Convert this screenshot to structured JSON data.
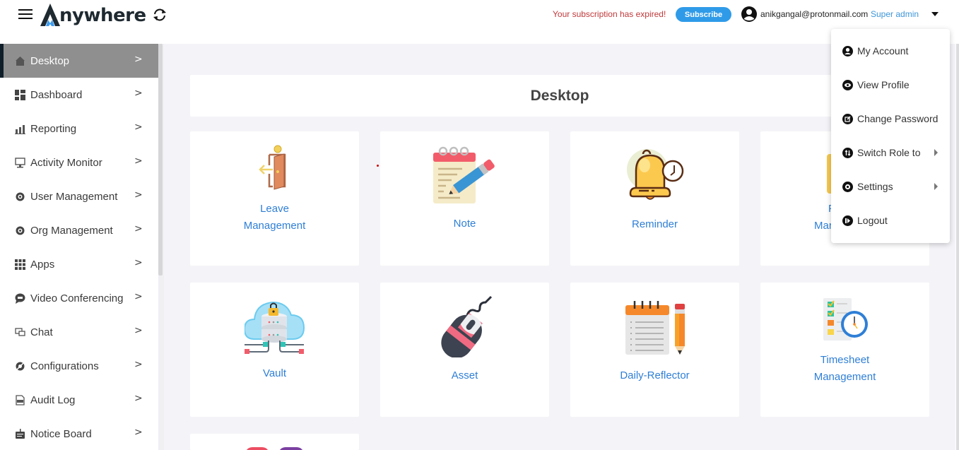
{
  "header": {
    "logo_text": "nywhere",
    "subscription_notice": "Your subscription has expired!",
    "subscribe_label": "Subscribe",
    "user_email": "anikgangal@protonmail.com",
    "user_role": "Super admin"
  },
  "colors": {
    "accent_blue": "#2f9be8",
    "link_blue": "#2f7fd6",
    "expired_red": "#c0393b",
    "sidebar_active": "#8f8f8f",
    "main_bg": "#f4f4f8"
  },
  "sidebar": {
    "items": [
      {
        "label": "Desktop",
        "icon": "home-icon",
        "active": true
      },
      {
        "label": "Dashboard",
        "icon": "dashboard-icon"
      },
      {
        "label": "Reporting",
        "icon": "bar-chart-icon"
      },
      {
        "label": "Activity Monitor",
        "icon": "monitor-icon"
      },
      {
        "label": "User Management",
        "icon": "gear-user-icon"
      },
      {
        "label": "Org Management",
        "icon": "gear-org-icon"
      },
      {
        "label": "Apps",
        "icon": "apps-grid-icon"
      },
      {
        "label": "Video Conferencing",
        "icon": "chat-bubble-icon"
      },
      {
        "label": "Chat",
        "icon": "chat-icon"
      },
      {
        "label": "Configurations",
        "icon": "config-gear-icon"
      },
      {
        "label": "Audit Log",
        "icon": "audit-doc-icon"
      },
      {
        "label": "Notice Board",
        "icon": "notice-board-icon"
      }
    ]
  },
  "main": {
    "title": "Desktop",
    "tiles": [
      {
        "label_lines": [
          "Leave",
          "Management"
        ],
        "icon": "door-exit-icon"
      },
      {
        "label_lines": [
          "Note"
        ],
        "icon": "notepad-pencil-icon"
      },
      {
        "label_lines": [
          "Reminder"
        ],
        "icon": "bell-clock-icon"
      },
      {
        "label_lines": [
          "F",
          "Mar"
        ],
        "icon": "folder-icon"
      },
      {
        "label_lines": [
          "Vault"
        ],
        "icon": "cloud-vault-icon"
      },
      {
        "label_lines": [
          "Asset"
        ],
        "icon": "mouse-icon"
      },
      {
        "label_lines": [
          "Daily-Reflector"
        ],
        "icon": "notebook-pencil-icon"
      },
      {
        "label_lines": [
          "Timesheet",
          "Management"
        ],
        "icon": "checklist-clock-icon"
      }
    ]
  },
  "user_menu": {
    "items": [
      {
        "label": "My Account",
        "icon": "account-icon"
      },
      {
        "label": "View Profile",
        "icon": "eye-icon"
      },
      {
        "label": "Change Password",
        "icon": "edit-icon"
      },
      {
        "label": "Switch Role to",
        "icon": "switch-role-icon",
        "submenu": true
      },
      {
        "label": "Settings",
        "icon": "settings-icon",
        "submenu": true
      },
      {
        "label": "Logout",
        "icon": "logout-icon"
      }
    ]
  }
}
